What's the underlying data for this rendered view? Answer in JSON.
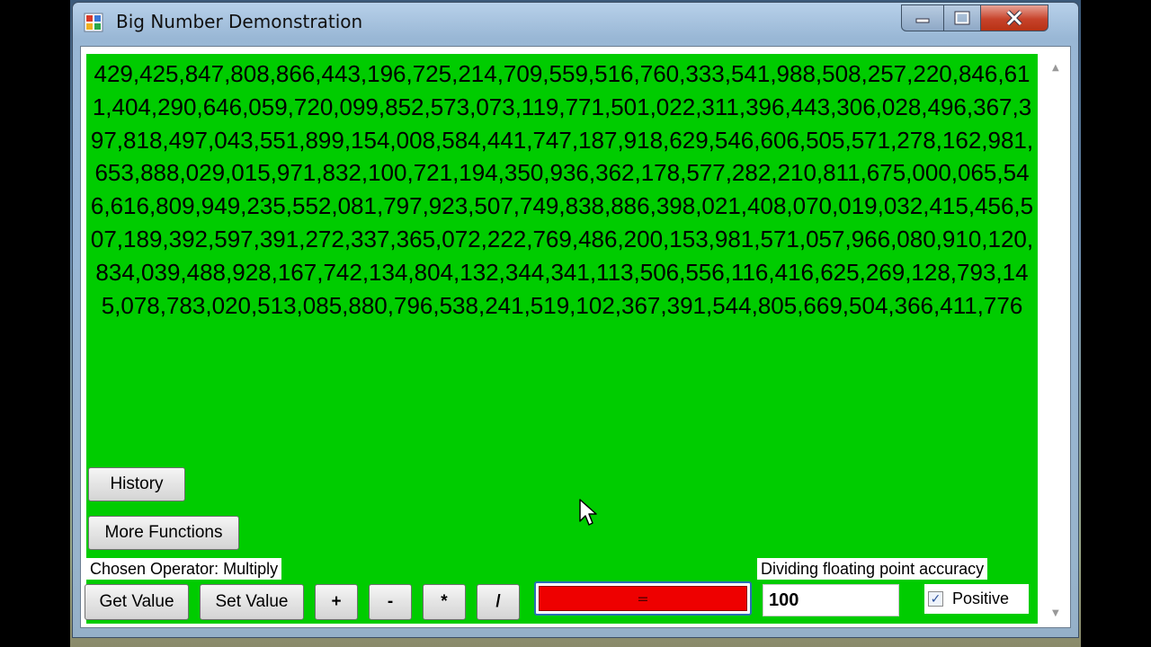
{
  "window": {
    "title": "Big Number Demonstration",
    "caption_buttons": {
      "minimize_icon": "minimize-icon",
      "maximize_icon": "maximize-icon",
      "close_icon": "close-icon"
    }
  },
  "display": {
    "value": "429,425,847,808,866,443,196,725,214,709,559,516,760,333,541,988,508,257,220,846,611,404,290,646,059,720,099,852,573,073,119,771,501,022,311,396,443,306,028,496,367,397,818,497,043,551,899,154,008,584,441,747,187,918,629,546,606,505,571,278,162,981,653,888,029,015,971,832,100,721,194,350,936,362,178,577,282,210,811,675,000,065,546,616,809,949,235,552,081,797,923,507,749,838,886,398,021,408,070,019,032,415,456,507,189,392,597,391,272,337,365,072,222,769,486,200,153,981,571,057,966,080,910,120,834,039,488,928,167,742,134,804,132,344,341,113,506,556,116,416,625,269,128,793,145,078,783,020,513,085,880,796,538,241,519,102,367,391,544,805,669,504,366,411,776",
    "background_color": "#00cc00"
  },
  "buttons": {
    "history": "History",
    "more_functions": "More Functions",
    "get_value": "Get Value",
    "set_value": "Set Value",
    "plus": "+",
    "minus": "-",
    "multiply": "*",
    "divide": "/",
    "equals": "="
  },
  "labels": {
    "chosen_operator": "Chosen Operator: Multiply",
    "accuracy": "Dividing floating point accuracy"
  },
  "accuracy_value": "100",
  "positive": {
    "label": "Positive",
    "checked": true,
    "check_glyph": "✓"
  },
  "equals_color": "#ee0000"
}
